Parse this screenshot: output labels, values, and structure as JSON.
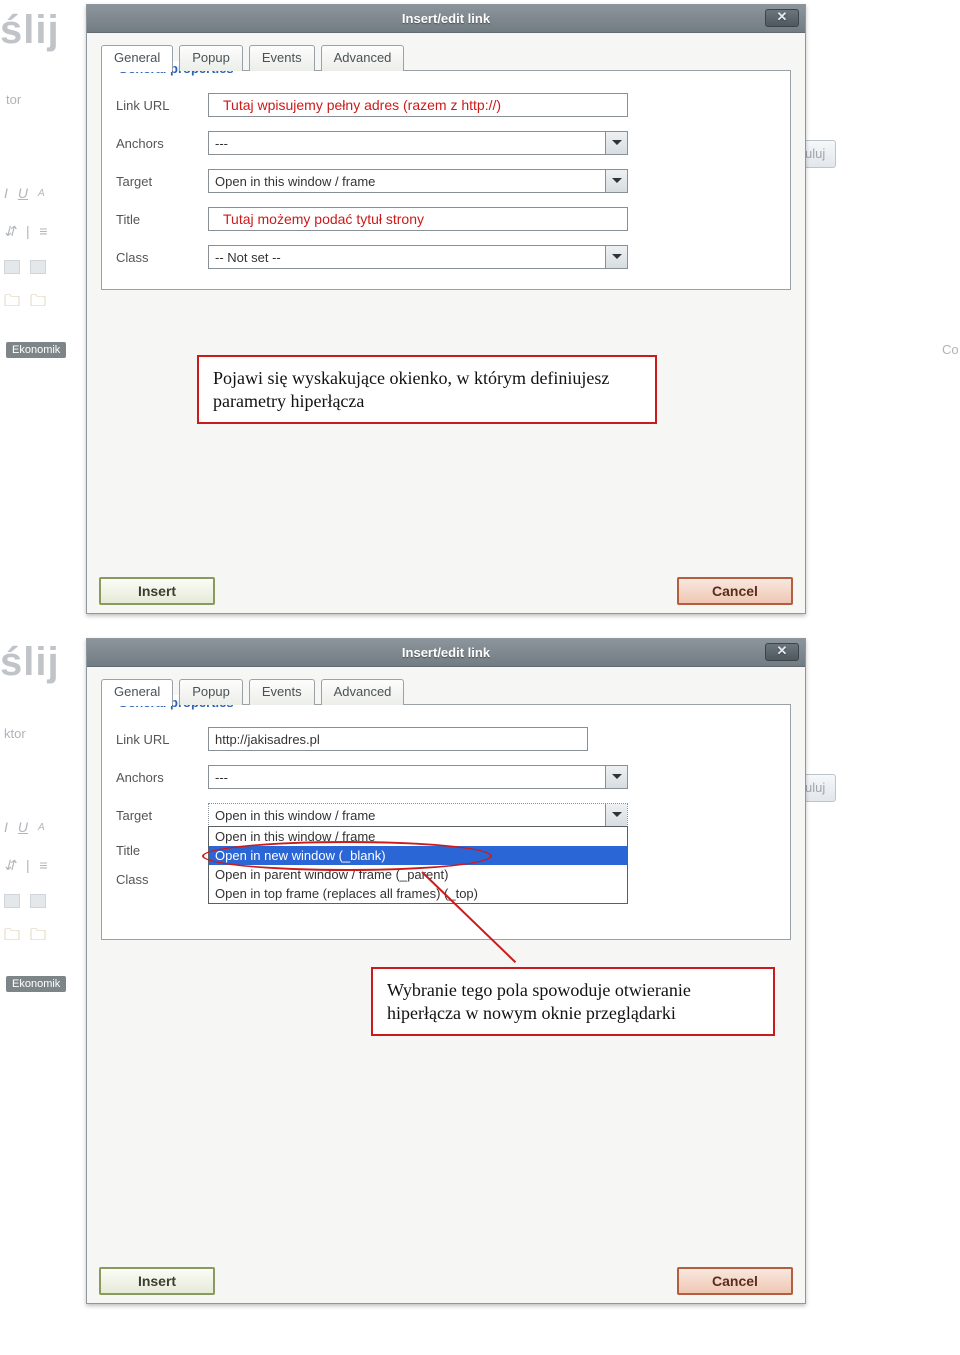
{
  "bg": {
    "heading": "ślij",
    "editor_label1": "tor",
    "editor_label2": "ktor",
    "side_btn": "uluj",
    "chip": "Ekonomik",
    "side_label": "Co"
  },
  "dialog1": {
    "title": "Insert/edit link",
    "close": "✕",
    "tabs": {
      "general": "General",
      "popup": "Popup",
      "events": "Events",
      "advanced": "Advanced"
    },
    "legend": "General properties",
    "labels": {
      "link_url": "Link URL",
      "anchors": "Anchors",
      "target": "Target",
      "title_l": "Title",
      "class_l": "Class"
    },
    "url_hint": "Tutaj wpisujemy pełny adres (razem z http://)",
    "anchors_value": "---",
    "target_value": "Open in this window / frame",
    "title_hint": "Tutaj możemy podać tytuł strony",
    "class_value": "-- Not set --",
    "note": "Pojawi się wyskakujące okienko, w którym definiujesz parametry hiperłącza",
    "insert": "Insert",
    "cancel": "Cancel"
  },
  "dialog2": {
    "title": "Insert/edit link",
    "close": "✕",
    "tabs": {
      "general": "General",
      "popup": "Popup",
      "events": "Events",
      "advanced": "Advanced"
    },
    "legend": "General properties",
    "labels": {
      "link_url": "Link URL",
      "anchors": "Anchors",
      "target": "Target",
      "title_l": "Title",
      "class_l": "Class"
    },
    "url_value": "http://jakisadres.pl",
    "anchors_value": "---",
    "target_value": "Open in this window / frame",
    "target_options": [
      "Open in this window / frame",
      "Open in new window (_blank)",
      "Open in parent window / frame (_parent)",
      "Open in top frame (replaces all frames) (_top)"
    ],
    "note": "Wybranie tego pola spowoduje otwieranie hiperłącza w nowym oknie przeglądarki",
    "insert": "Insert",
    "cancel": "Cancel"
  }
}
